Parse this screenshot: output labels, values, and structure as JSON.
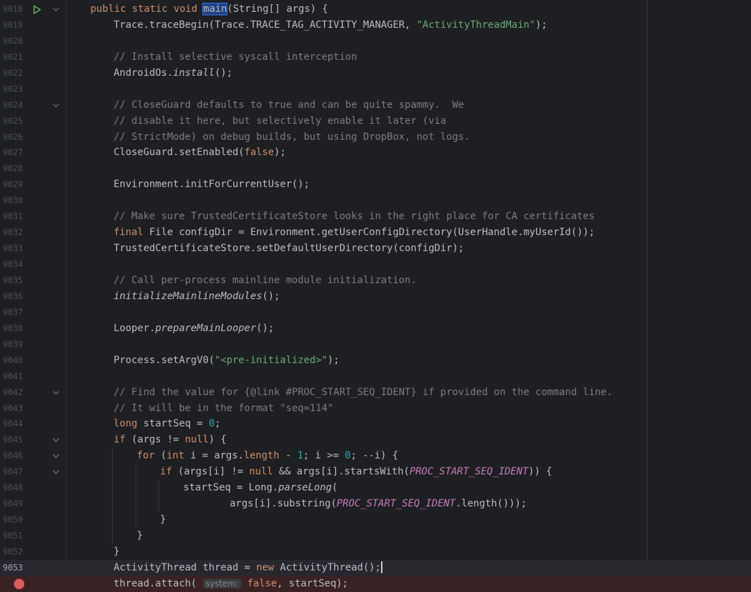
{
  "editor": {
    "colors": {
      "background": "#1e1f22",
      "keyword": "#cf8e6d",
      "comment": "#7a7e85",
      "string": "#6aab73",
      "number": "#2aacb8",
      "constant": "#c77dbb",
      "breakpoint": "#db5c5c",
      "run_icon": "#5fb865"
    },
    "breakpoint_icon": "breakpoint-dot-icon",
    "run_icon": "run-triangle-icon",
    "fold_icon": "chevron-down-icon",
    "lines": [
      {
        "num": "9018",
        "run": true,
        "fold": true,
        "indent": 0,
        "tokens": [
          {
            "t": "public static void ",
            "c": "kw"
          },
          {
            "t": "main",
            "c": "hl"
          },
          {
            "t": "(String[] args) {"
          }
        ]
      },
      {
        "num": "9019",
        "indent": 1,
        "tokens": [
          {
            "t": "Trace.traceBegin(Trace.TRACE_TAG_ACTIVITY_MANAGER, "
          },
          {
            "t": "\"ActivityThreadMain\"",
            "c": "str"
          },
          {
            "t": ");"
          }
        ]
      },
      {
        "num": "9020",
        "indent": 1,
        "tokens": []
      },
      {
        "num": "9021",
        "indent": 1,
        "tokens": [
          {
            "t": "// Install selective syscall interception",
            "c": "cm"
          }
        ]
      },
      {
        "num": "9022",
        "indent": 1,
        "tokens": [
          {
            "t": "AndroidOs."
          },
          {
            "t": "install",
            "c": "it"
          },
          {
            "t": "();"
          }
        ]
      },
      {
        "num": "9023",
        "indent": 1,
        "tokens": []
      },
      {
        "num": "9024",
        "fold": true,
        "indent": 1,
        "tokens": [
          {
            "t": "// CloseGuard defaults to true and can be quite spammy.  We",
            "c": "cm"
          }
        ]
      },
      {
        "num": "9025",
        "indent": 1,
        "tokens": [
          {
            "t": "// disable it here, but selectively enable it later (via",
            "c": "cm"
          }
        ]
      },
      {
        "num": "9026",
        "indent": 1,
        "tokens": [
          {
            "t": "// StrictMode) on debug builds, but using DropBox, not logs.",
            "c": "cm"
          }
        ]
      },
      {
        "num": "9027",
        "indent": 1,
        "tokens": [
          {
            "t": "CloseGuard.setEnabled("
          },
          {
            "t": "false",
            "c": "kw"
          },
          {
            "t": ");"
          }
        ]
      },
      {
        "num": "9028",
        "indent": 1,
        "tokens": []
      },
      {
        "num": "9029",
        "indent": 1,
        "tokens": [
          {
            "t": "Environment.initForCurrentUser();"
          }
        ]
      },
      {
        "num": "9030",
        "indent": 1,
        "tokens": []
      },
      {
        "num": "9031",
        "indent": 1,
        "tokens": [
          {
            "t": "// Make sure TrustedCertificateStore looks in the right place for CA certificates",
            "c": "cm"
          }
        ]
      },
      {
        "num": "9032",
        "indent": 1,
        "tokens": [
          {
            "t": "final ",
            "c": "kw"
          },
          {
            "t": "File configDir = Environment.getUserConfigDirectory(UserHandle.myUserId());"
          }
        ]
      },
      {
        "num": "9033",
        "indent": 1,
        "tokens": [
          {
            "t": "TrustedCertificateStore.setDefaultUserDirectory(configDir);"
          }
        ]
      },
      {
        "num": "9034",
        "indent": 1,
        "tokens": []
      },
      {
        "num": "9035",
        "indent": 1,
        "tokens": [
          {
            "t": "// Call per-process mainline module initialization.",
            "c": "cm"
          }
        ]
      },
      {
        "num": "9036",
        "indent": 1,
        "tokens": [
          {
            "t": "initializeMainlineModules",
            "c": "it"
          },
          {
            "t": "();"
          }
        ]
      },
      {
        "num": "9037",
        "indent": 1,
        "tokens": []
      },
      {
        "num": "9038",
        "indent": 1,
        "tokens": [
          {
            "t": "Looper."
          },
          {
            "t": "prepareMainLooper",
            "c": "it"
          },
          {
            "t": "();"
          }
        ]
      },
      {
        "num": "9039",
        "indent": 1,
        "tokens": []
      },
      {
        "num": "9040",
        "indent": 1,
        "tokens": [
          {
            "t": "Process.setArgV0("
          },
          {
            "t": "\"<pre-initialized>\"",
            "c": "str"
          },
          {
            "t": ");"
          }
        ]
      },
      {
        "num": "9041",
        "indent": 1,
        "tokens": []
      },
      {
        "num": "9042",
        "fold": true,
        "indent": 1,
        "tokens": [
          {
            "t": "// Find the value for {@link #PROC_START_SEQ_IDENT} if provided on the command line.",
            "c": "cm"
          }
        ]
      },
      {
        "num": "9043",
        "indent": 1,
        "tokens": [
          {
            "t": "// It will be in the format \"seq=114\"",
            "c": "cm"
          }
        ]
      },
      {
        "num": "9044",
        "indent": 1,
        "tokens": [
          {
            "t": "long ",
            "c": "kw"
          },
          {
            "t": "startSeq = "
          },
          {
            "t": "0",
            "c": "num"
          },
          {
            "t": ";"
          }
        ]
      },
      {
        "num": "9045",
        "fold": true,
        "indent": 1,
        "tokens": [
          {
            "t": "if ",
            "c": "kw"
          },
          {
            "t": "(args != "
          },
          {
            "t": "null",
            "c": "kw"
          },
          {
            "t": ") {"
          }
        ]
      },
      {
        "num": "9046",
        "fold": true,
        "indent": 2,
        "tokens": [
          {
            "t": "for ",
            "c": "kw"
          },
          {
            "t": "("
          },
          {
            "t": "int ",
            "c": "kw"
          },
          {
            "t": "i = args."
          },
          {
            "t": "length",
            "c": "kw"
          },
          {
            "t": " - "
          },
          {
            "t": "1",
            "c": "num"
          },
          {
            "t": "; i >= "
          },
          {
            "t": "0",
            "c": "num"
          },
          {
            "t": "; --i) {"
          }
        ]
      },
      {
        "num": "9047",
        "fold": true,
        "indent": 3,
        "tokens": [
          {
            "t": "if ",
            "c": "kw"
          },
          {
            "t": "(args[i] != "
          },
          {
            "t": "null",
            "c": "kw"
          },
          {
            "t": " && args[i].startsWith("
          },
          {
            "t": "PROC_START_SEQ_IDENT",
            "c": "cst"
          },
          {
            "t": ")) {"
          }
        ]
      },
      {
        "num": "9048",
        "indent": 4,
        "tokens": [
          {
            "t": "startSeq = Long."
          },
          {
            "t": "parseLong",
            "c": "it"
          },
          {
            "t": "("
          }
        ]
      },
      {
        "num": "9049",
        "indent": 6,
        "tokens": [
          {
            "t": "args[i].substring("
          },
          {
            "t": "PROC_START_SEQ_IDENT",
            "c": "cst"
          },
          {
            "t": ".length()));"
          }
        ]
      },
      {
        "num": "9050",
        "indent": 3,
        "tokens": [
          {
            "t": "}"
          }
        ]
      },
      {
        "num": "9051",
        "indent": 2,
        "tokens": [
          {
            "t": "}"
          }
        ]
      },
      {
        "num": "9052",
        "indent": 1,
        "tokens": [
          {
            "t": "}"
          }
        ]
      },
      {
        "num": "9053",
        "current": true,
        "caret": true,
        "indent": 1,
        "tokens": [
          {
            "t": "ActivityThread thread = "
          },
          {
            "t": "new ",
            "c": "kw"
          },
          {
            "t": "ActivityThread();"
          }
        ]
      },
      {
        "num": "",
        "breakpoint": true,
        "indent": 1,
        "tokens": [
          {
            "t": "thread.attach( "
          },
          {
            "t": "system:",
            "c": "hint"
          },
          {
            "t": " "
          },
          {
            "t": "false",
            "c": "kw"
          },
          {
            "t": ", startSeq);"
          }
        ]
      }
    ]
  }
}
